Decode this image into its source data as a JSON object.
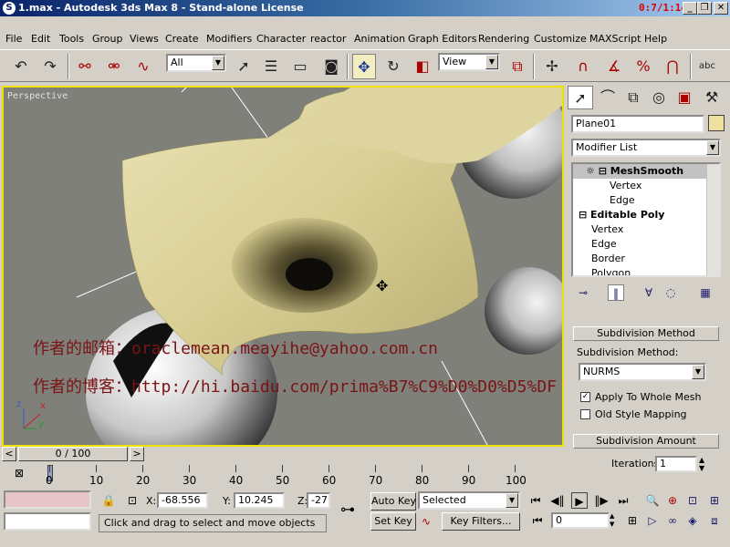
{
  "window": {
    "title": "1.max - Autodesk 3ds Max 8 - Stand-alone License",
    "timer": "0:7/1:14",
    "minimize": "_",
    "restore": "❐",
    "close": "✕"
  },
  "menu": [
    "File",
    "Edit",
    "Tools",
    "Group",
    "Views",
    "Create",
    "Modifiers",
    "Character",
    "reactor",
    "Animation",
    "Graph Editors",
    "Rendering",
    "Customize",
    "MAXScript",
    "Help"
  ],
  "toolbar": {
    "selection_filter": "All",
    "reference_coord": "View"
  },
  "viewport": {
    "label": "Perspective",
    "watermark_email": "作者的邮箱：oraclemean.meayihe@yahoo.com.cn",
    "watermark_blog": "作者的博客：http://hi.baidu.com/prima%B7%C9%D0%D0%D5%DF",
    "axis_x": "x",
    "axis_y": "y",
    "axis_z": "z"
  },
  "command_panel": {
    "object_name": "Plane01",
    "modifier_list": "Modifier List",
    "stack": [
      {
        "label": "MeshSmooth",
        "bold": true,
        "level": 0
      },
      {
        "label": "Vertex",
        "bold": false,
        "level": 2
      },
      {
        "label": "Edge",
        "bold": false,
        "level": 2
      },
      {
        "label": "Editable Poly",
        "bold": true,
        "level": 0
      },
      {
        "label": "Vertex",
        "bold": false,
        "level": 1
      },
      {
        "label": "Edge",
        "bold": false,
        "level": 1
      },
      {
        "label": "Border",
        "bold": false,
        "level": 1
      },
      {
        "label": "Polygon",
        "bold": false,
        "level": 1
      }
    ],
    "subdivision_method_header": "Subdivision Method",
    "subdivision_method_label": "Subdivision Method:",
    "subdivision_method_value": "NURMS",
    "apply_whole_mesh": "Apply To Whole Mesh",
    "apply_whole_mesh_checked": "✓",
    "old_style_mapping": "Old Style Mapping",
    "subdivision_amount_header": "Subdivision Amount",
    "iterations_label": "Iterations:",
    "iterations_value": "1"
  },
  "timeline": {
    "frame_label": "0 / 100",
    "prev": "<",
    "next": ">",
    "ticks": [
      "0",
      "10",
      "20",
      "30",
      "40",
      "50",
      "60",
      "70",
      "80",
      "90",
      "100"
    ]
  },
  "status": {
    "x_label": "X:",
    "x_value": "-68.556",
    "y_label": "Y:",
    "y_value": "10.245",
    "z_label": "Z:",
    "z_value": "-27.0",
    "prompt": "Click and drag to select and move objects",
    "auto_key": "Auto Key",
    "set_key": "Set Key",
    "key_mode": "Selected",
    "key_filters": "Key Filters...",
    "current_frame": "0"
  }
}
